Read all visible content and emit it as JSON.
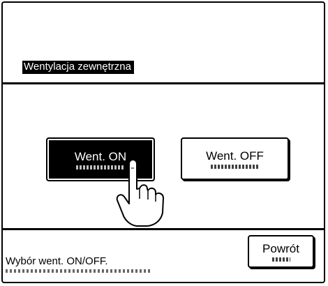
{
  "screen": {
    "title": "Wentylacja zewnętrzna",
    "status_text": "Wybór went. ON/OFF."
  },
  "buttons": {
    "on_label": "Went. ON",
    "off_label": "Went. OFF",
    "back_label": "Powrót"
  },
  "state": {
    "selected": "Went. ON"
  },
  "icons": {
    "pointer": "hand-pointer-icon"
  },
  "colors": {
    "background": "#ffffff",
    "foreground": "#000000"
  }
}
